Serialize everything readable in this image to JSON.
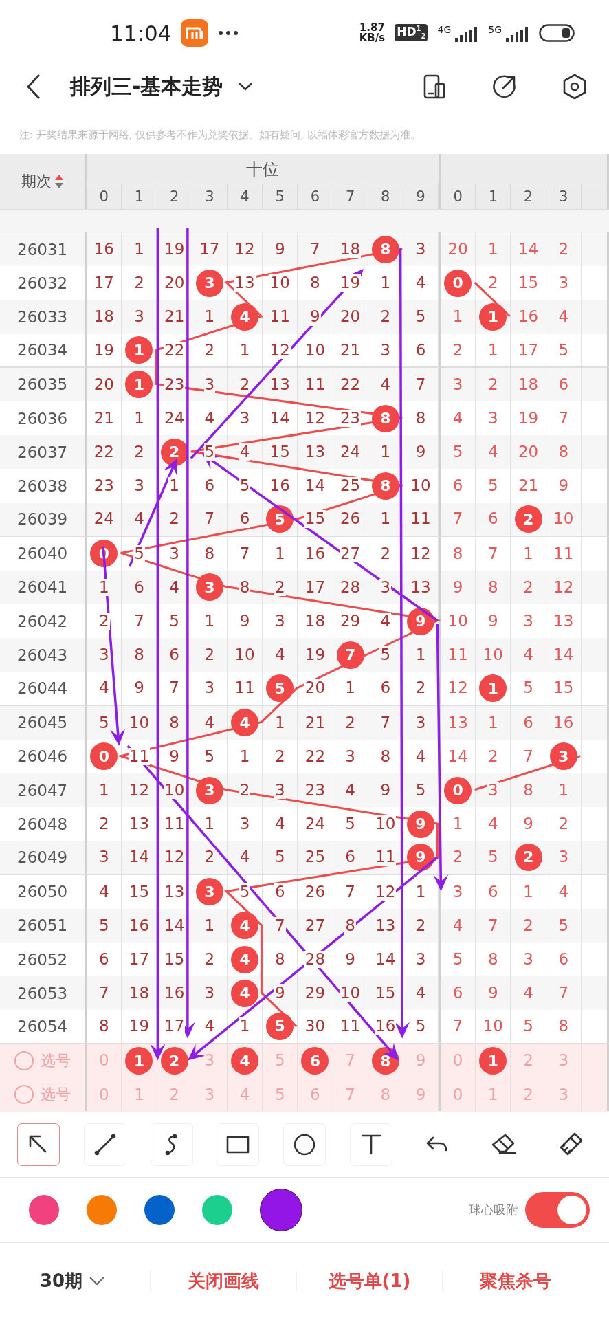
{
  "status_bar": {
    "time": "11:04",
    "speed_value": "1.87",
    "speed_unit": "KB/s",
    "hd_badge": "HD$^{1}$$_{2}$",
    "sim1": "4G",
    "sim2": "5G"
  },
  "header": {
    "title": "排列三-基本走势"
  },
  "note": "注: 开奖结果来源于网络, 仅供参考不作为兑奖依据。如有疑问, 以福体彩官方数据为准。",
  "table": {
    "period_header": "期次",
    "groups": [
      {
        "title": "十位",
        "digits": [
          "0",
          "1",
          "2",
          "3",
          "4",
          "5",
          "6",
          "7",
          "8",
          "9"
        ]
      },
      {
        "digits": [
          "0",
          "1",
          "2",
          "3"
        ]
      }
    ],
    "rows": [
      {
        "period": "26031",
        "groups": [
          [
            {
              "v": "16",
              "hit": false
            },
            {
              "v": "1",
              "hit": false
            },
            {
              "v": "19",
              "hit": false
            },
            {
              "v": "17",
              "hit": false
            },
            {
              "v": "12",
              "hit": false
            },
            {
              "v": "9",
              "hit": false
            },
            {
              "v": "7",
              "hit": false
            },
            {
              "v": "18",
              "hit": false
            },
            {
              "v": "8",
              "hit": true
            },
            {
              "v": "3",
              "hit": false
            }
          ],
          [
            {
              "v": "20",
              "hit": false
            },
            {
              "v": "1",
              "hit": false
            },
            {
              "v": "14",
              "hit": false
            },
            {
              "v": "2",
              "hit": false
            }
          ]
        ]
      },
      {
        "period": "26032",
        "groups": [
          [
            {
              "v": "17",
              "hit": false
            },
            {
              "v": "2",
              "hit": false
            },
            {
              "v": "20",
              "hit": false
            },
            {
              "v": "3",
              "hit": true
            },
            {
              "v": "13",
              "hit": false
            },
            {
              "v": "10",
              "hit": false
            },
            {
              "v": "8",
              "hit": false
            },
            {
              "v": "19",
              "hit": false
            },
            {
              "v": "1",
              "hit": false
            },
            {
              "v": "4",
              "hit": false
            }
          ],
          [
            {
              "v": "0",
              "hit": true
            },
            {
              "v": "2",
              "hit": false
            },
            {
              "v": "15",
              "hit": false
            },
            {
              "v": "3",
              "hit": false
            }
          ]
        ]
      },
      {
        "period": "26033",
        "groups": [
          [
            {
              "v": "18",
              "hit": false
            },
            {
              "v": "3",
              "hit": false
            },
            {
              "v": "21",
              "hit": false
            },
            {
              "v": "1",
              "hit": false
            },
            {
              "v": "4",
              "hit": true
            },
            {
              "v": "11",
              "hit": false
            },
            {
              "v": "9",
              "hit": false
            },
            {
              "v": "20",
              "hit": false
            },
            {
              "v": "2",
              "hit": false
            },
            {
              "v": "5",
              "hit": false
            }
          ],
          [
            {
              "v": "1",
              "hit": false
            },
            {
              "v": "1",
              "hit": true
            },
            {
              "v": "16",
              "hit": false
            },
            {
              "v": "4",
              "hit": false
            }
          ]
        ]
      },
      {
        "period": "26034",
        "groups": [
          [
            {
              "v": "19",
              "hit": false
            },
            {
              "v": "1",
              "hit": true
            },
            {
              "v": "22",
              "hit": false
            },
            {
              "v": "2",
              "hit": false
            },
            {
              "v": "1",
              "hit": false
            },
            {
              "v": "12",
              "hit": false
            },
            {
              "v": "10",
              "hit": false
            },
            {
              "v": "21",
              "hit": false
            },
            {
              "v": "3",
              "hit": false
            },
            {
              "v": "6",
              "hit": false
            }
          ],
          [
            {
              "v": "2",
              "hit": false
            },
            {
              "v": "1",
              "hit": false
            },
            {
              "v": "17",
              "hit": false
            },
            {
              "v": "5",
              "hit": false
            }
          ]
        ]
      },
      {
        "period": "26035",
        "groups": [
          [
            {
              "v": "20",
              "hit": false
            },
            {
              "v": "1",
              "hit": true
            },
            {
              "v": "23",
              "hit": false
            },
            {
              "v": "3",
              "hit": false
            },
            {
              "v": "2",
              "hit": false
            },
            {
              "v": "13",
              "hit": false
            },
            {
              "v": "11",
              "hit": false
            },
            {
              "v": "22",
              "hit": false
            },
            {
              "v": "4",
              "hit": false
            },
            {
              "v": "7",
              "hit": false
            }
          ],
          [
            {
              "v": "3",
              "hit": false
            },
            {
              "v": "2",
              "hit": false
            },
            {
              "v": "18",
              "hit": false
            },
            {
              "v": "6",
              "hit": false
            }
          ]
        ]
      },
      {
        "period": "26036",
        "groups": [
          [
            {
              "v": "21",
              "hit": false
            },
            {
              "v": "1",
              "hit": false
            },
            {
              "v": "24",
              "hit": false
            },
            {
              "v": "4",
              "hit": false
            },
            {
              "v": "3",
              "hit": false
            },
            {
              "v": "14",
              "hit": false
            },
            {
              "v": "12",
              "hit": false
            },
            {
              "v": "23",
              "hit": false
            },
            {
              "v": "8",
              "hit": true
            },
            {
              "v": "8",
              "hit": false
            }
          ],
          [
            {
              "v": "4",
              "hit": false
            },
            {
              "v": "3",
              "hit": false
            },
            {
              "v": "19",
              "hit": false
            },
            {
              "v": "7",
              "hit": false
            }
          ]
        ]
      },
      {
        "period": "26037",
        "groups": [
          [
            {
              "v": "22",
              "hit": false
            },
            {
              "v": "2",
              "hit": false
            },
            {
              "v": "2",
              "hit": true
            },
            {
              "v": "5",
              "hit": false
            },
            {
              "v": "4",
              "hit": false
            },
            {
              "v": "15",
              "hit": false
            },
            {
              "v": "13",
              "hit": false
            },
            {
              "v": "24",
              "hit": false
            },
            {
              "v": "1",
              "hit": false
            },
            {
              "v": "9",
              "hit": false
            }
          ],
          [
            {
              "v": "5",
              "hit": false
            },
            {
              "v": "4",
              "hit": false
            },
            {
              "v": "20",
              "hit": false
            },
            {
              "v": "8",
              "hit": false
            }
          ]
        ]
      },
      {
        "period": "26038",
        "groups": [
          [
            {
              "v": "23",
              "hit": false
            },
            {
              "v": "3",
              "hit": false
            },
            {
              "v": "1",
              "hit": false
            },
            {
              "v": "6",
              "hit": false
            },
            {
              "v": "5",
              "hit": false
            },
            {
              "v": "16",
              "hit": false
            },
            {
              "v": "14",
              "hit": false
            },
            {
              "v": "25",
              "hit": false
            },
            {
              "v": "8",
              "hit": true
            },
            {
              "v": "10",
              "hit": false
            }
          ],
          [
            {
              "v": "6",
              "hit": false
            },
            {
              "v": "5",
              "hit": false
            },
            {
              "v": "21",
              "hit": false
            },
            {
              "v": "9",
              "hit": false
            }
          ]
        ]
      },
      {
        "period": "26039",
        "groups": [
          [
            {
              "v": "24",
              "hit": false
            },
            {
              "v": "4",
              "hit": false
            },
            {
              "v": "2",
              "hit": false
            },
            {
              "v": "7",
              "hit": false
            },
            {
              "v": "6",
              "hit": false
            },
            {
              "v": "5",
              "hit": true
            },
            {
              "v": "15",
              "hit": false
            },
            {
              "v": "26",
              "hit": false
            },
            {
              "v": "1",
              "hit": false
            },
            {
              "v": "11",
              "hit": false
            }
          ],
          [
            {
              "v": "7",
              "hit": false
            },
            {
              "v": "6",
              "hit": false
            },
            {
              "v": "2",
              "hit": true
            },
            {
              "v": "10",
              "hit": false
            }
          ]
        ]
      },
      {
        "period": "26040",
        "groups": [
          [
            {
              "v": "0",
              "hit": true
            },
            {
              "v": "5",
              "hit": false
            },
            {
              "v": "3",
              "hit": false
            },
            {
              "v": "8",
              "hit": false
            },
            {
              "v": "7",
              "hit": false
            },
            {
              "v": "1",
              "hit": false
            },
            {
              "v": "16",
              "hit": false
            },
            {
              "v": "27",
              "hit": false
            },
            {
              "v": "2",
              "hit": false
            },
            {
              "v": "12",
              "hit": false
            }
          ],
          [
            {
              "v": "8",
              "hit": false
            },
            {
              "v": "7",
              "hit": false
            },
            {
              "v": "1",
              "hit": false
            },
            {
              "v": "11",
              "hit": false
            }
          ]
        ]
      },
      {
        "period": "26041",
        "groups": [
          [
            {
              "v": "1",
              "hit": false
            },
            {
              "v": "6",
              "hit": false
            },
            {
              "v": "4",
              "hit": false
            },
            {
              "v": "3",
              "hit": true
            },
            {
              "v": "8",
              "hit": false
            },
            {
              "v": "2",
              "hit": false
            },
            {
              "v": "17",
              "hit": false
            },
            {
              "v": "28",
              "hit": false
            },
            {
              "v": "3",
              "hit": false
            },
            {
              "v": "13",
              "hit": false
            }
          ],
          [
            {
              "v": "9",
              "hit": false
            },
            {
              "v": "8",
              "hit": false
            },
            {
              "v": "2",
              "hit": false
            },
            {
              "v": "12",
              "hit": false
            }
          ]
        ]
      },
      {
        "period": "26042",
        "groups": [
          [
            {
              "v": "2",
              "hit": false
            },
            {
              "v": "7",
              "hit": false
            },
            {
              "v": "5",
              "hit": false
            },
            {
              "v": "1",
              "hit": false
            },
            {
              "v": "9",
              "hit": false
            },
            {
              "v": "3",
              "hit": false
            },
            {
              "v": "18",
              "hit": false
            },
            {
              "v": "29",
              "hit": false
            },
            {
              "v": "4",
              "hit": false
            },
            {
              "v": "9",
              "hit": true
            }
          ],
          [
            {
              "v": "10",
              "hit": false
            },
            {
              "v": "9",
              "hit": false
            },
            {
              "v": "3",
              "hit": false
            },
            {
              "v": "13",
              "hit": false
            }
          ]
        ]
      },
      {
        "period": "26043",
        "groups": [
          [
            {
              "v": "3",
              "hit": false
            },
            {
              "v": "8",
              "hit": false
            },
            {
              "v": "6",
              "hit": false
            },
            {
              "v": "2",
              "hit": false
            },
            {
              "v": "10",
              "hit": false
            },
            {
              "v": "4",
              "hit": false
            },
            {
              "v": "19",
              "hit": false
            },
            {
              "v": "7",
              "hit": true
            },
            {
              "v": "5",
              "hit": false
            },
            {
              "v": "1",
              "hit": false
            }
          ],
          [
            {
              "v": "11",
              "hit": false
            },
            {
              "v": "10",
              "hit": false
            },
            {
              "v": "4",
              "hit": false
            },
            {
              "v": "14",
              "hit": false
            }
          ]
        ]
      },
      {
        "period": "26044",
        "groups": [
          [
            {
              "v": "4",
              "hit": false
            },
            {
              "v": "9",
              "hit": false
            },
            {
              "v": "7",
              "hit": false
            },
            {
              "v": "3",
              "hit": false
            },
            {
              "v": "11",
              "hit": false
            },
            {
              "v": "5",
              "hit": true
            },
            {
              "v": "20",
              "hit": false
            },
            {
              "v": "1",
              "hit": false
            },
            {
              "v": "6",
              "hit": false
            },
            {
              "v": "2",
              "hit": false
            }
          ],
          [
            {
              "v": "12",
              "hit": false
            },
            {
              "v": "1",
              "hit": true
            },
            {
              "v": "5",
              "hit": false
            },
            {
              "v": "15",
              "hit": false
            }
          ]
        ]
      },
      {
        "period": "26045",
        "groups": [
          [
            {
              "v": "5",
              "hit": false
            },
            {
              "v": "10",
              "hit": false
            },
            {
              "v": "8",
              "hit": false
            },
            {
              "v": "4",
              "hit": false
            },
            {
              "v": "4",
              "hit": true
            },
            {
              "v": "1",
              "hit": false
            },
            {
              "v": "21",
              "hit": false
            },
            {
              "v": "2",
              "hit": false
            },
            {
              "v": "7",
              "hit": false
            },
            {
              "v": "3",
              "hit": false
            }
          ],
          [
            {
              "v": "13",
              "hit": false
            },
            {
              "v": "1",
              "hit": false
            },
            {
              "v": "6",
              "hit": false
            },
            {
              "v": "16",
              "hit": false
            }
          ]
        ]
      },
      {
        "period": "26046",
        "groups": [
          [
            {
              "v": "0",
              "hit": true
            },
            {
              "v": "11",
              "hit": false
            },
            {
              "v": "9",
              "hit": false
            },
            {
              "v": "5",
              "hit": false
            },
            {
              "v": "1",
              "hit": false
            },
            {
              "v": "2",
              "hit": false
            },
            {
              "v": "22",
              "hit": false
            },
            {
              "v": "3",
              "hit": false
            },
            {
              "v": "8",
              "hit": false
            },
            {
              "v": "4",
              "hit": false
            }
          ],
          [
            {
              "v": "14",
              "hit": false
            },
            {
              "v": "2",
              "hit": false
            },
            {
              "v": "7",
              "hit": false
            },
            {
              "v": "3",
              "hit": true
            }
          ]
        ]
      },
      {
        "period": "26047",
        "groups": [
          [
            {
              "v": "1",
              "hit": false
            },
            {
              "v": "12",
              "hit": false
            },
            {
              "v": "10",
              "hit": false
            },
            {
              "v": "3",
              "hit": true
            },
            {
              "v": "2",
              "hit": false
            },
            {
              "v": "3",
              "hit": false
            },
            {
              "v": "23",
              "hit": false
            },
            {
              "v": "4",
              "hit": false
            },
            {
              "v": "9",
              "hit": false
            },
            {
              "v": "5",
              "hit": false
            }
          ],
          [
            {
              "v": "0",
              "hit": true
            },
            {
              "v": "3",
              "hit": false
            },
            {
              "v": "8",
              "hit": false
            },
            {
              "v": "1",
              "hit": false
            }
          ]
        ]
      },
      {
        "period": "26048",
        "groups": [
          [
            {
              "v": "2",
              "hit": false
            },
            {
              "v": "13",
              "hit": false
            },
            {
              "v": "11",
              "hit": false
            },
            {
              "v": "1",
              "hit": false
            },
            {
              "v": "3",
              "hit": false
            },
            {
              "v": "4",
              "hit": false
            },
            {
              "v": "24",
              "hit": false
            },
            {
              "v": "5",
              "hit": false
            },
            {
              "v": "10",
              "hit": false
            },
            {
              "v": "9",
              "hit": true
            }
          ],
          [
            {
              "v": "1",
              "hit": false
            },
            {
              "v": "4",
              "hit": false
            },
            {
              "v": "9",
              "hit": false
            },
            {
              "v": "2",
              "hit": false
            }
          ]
        ]
      },
      {
        "period": "26049",
        "groups": [
          [
            {
              "v": "3",
              "hit": false
            },
            {
              "v": "14",
              "hit": false
            },
            {
              "v": "12",
              "hit": false
            },
            {
              "v": "2",
              "hit": false
            },
            {
              "v": "4",
              "hit": false
            },
            {
              "v": "5",
              "hit": false
            },
            {
              "v": "25",
              "hit": false
            },
            {
              "v": "6",
              "hit": false
            },
            {
              "v": "11",
              "hit": false
            },
            {
              "v": "9",
              "hit": true
            }
          ],
          [
            {
              "v": "2",
              "hit": false
            },
            {
              "v": "5",
              "hit": false
            },
            {
              "v": "2",
              "hit": true
            },
            {
              "v": "3",
              "hit": false
            }
          ]
        ]
      },
      {
        "period": "26050",
        "groups": [
          [
            {
              "v": "4",
              "hit": false
            },
            {
              "v": "15",
              "hit": false
            },
            {
              "v": "13",
              "hit": false
            },
            {
              "v": "3",
              "hit": true
            },
            {
              "v": "5",
              "hit": false
            },
            {
              "v": "6",
              "hit": false
            },
            {
              "v": "26",
              "hit": false
            },
            {
              "v": "7",
              "hit": false
            },
            {
              "v": "12",
              "hit": false
            },
            {
              "v": "1",
              "hit": false
            }
          ],
          [
            {
              "v": "3",
              "hit": false
            },
            {
              "v": "6",
              "hit": false
            },
            {
              "v": "1",
              "hit": false
            },
            {
              "v": "4",
              "hit": false
            }
          ]
        ]
      },
      {
        "period": "26051",
        "groups": [
          [
            {
              "v": "5",
              "hit": false
            },
            {
              "v": "16",
              "hit": false
            },
            {
              "v": "14",
              "hit": false
            },
            {
              "v": "1",
              "hit": false
            },
            {
              "v": "4",
              "hit": true
            },
            {
              "v": "7",
              "hit": false
            },
            {
              "v": "27",
              "hit": false
            },
            {
              "v": "8",
              "hit": false
            },
            {
              "v": "13",
              "hit": false
            },
            {
              "v": "2",
              "hit": false
            }
          ],
          [
            {
              "v": "4",
              "hit": false
            },
            {
              "v": "7",
              "hit": false
            },
            {
              "v": "2",
              "hit": false
            },
            {
              "v": "5",
              "hit": false
            }
          ]
        ]
      },
      {
        "period": "26052",
        "groups": [
          [
            {
              "v": "6",
              "hit": false
            },
            {
              "v": "17",
              "hit": false
            },
            {
              "v": "15",
              "hit": false
            },
            {
              "v": "2",
              "hit": false
            },
            {
              "v": "4",
              "hit": true
            },
            {
              "v": "8",
              "hit": false
            },
            {
              "v": "28",
              "hit": false
            },
            {
              "v": "9",
              "hit": false
            },
            {
              "v": "14",
              "hit": false
            },
            {
              "v": "3",
              "hit": false
            }
          ],
          [
            {
              "v": "5",
              "hit": false
            },
            {
              "v": "8",
              "hit": false
            },
            {
              "v": "3",
              "hit": false
            },
            {
              "v": "6",
              "hit": false
            }
          ]
        ]
      },
      {
        "period": "26053",
        "groups": [
          [
            {
              "v": "7",
              "hit": false
            },
            {
              "v": "18",
              "hit": false
            },
            {
              "v": "16",
              "hit": false
            },
            {
              "v": "3",
              "hit": false
            },
            {
              "v": "4",
              "hit": true
            },
            {
              "v": "9",
              "hit": false
            },
            {
              "v": "29",
              "hit": false
            },
            {
              "v": "10",
              "hit": false
            },
            {
              "v": "15",
              "hit": false
            },
            {
              "v": "4",
              "hit": false
            }
          ],
          [
            {
              "v": "6",
              "hit": false
            },
            {
              "v": "9",
              "hit": false
            },
            {
              "v": "4",
              "hit": false
            },
            {
              "v": "7",
              "hit": false
            }
          ]
        ]
      },
      {
        "period": "26054",
        "groups": [
          [
            {
              "v": "8",
              "hit": false
            },
            {
              "v": "19",
              "hit": false
            },
            {
              "v": "17",
              "hit": false
            },
            {
              "v": "4",
              "hit": false
            },
            {
              "v": "1",
              "hit": false
            },
            {
              "v": "5",
              "hit": true
            },
            {
              "v": "30",
              "hit": false
            },
            {
              "v": "11",
              "hit": false
            },
            {
              "v": "16",
              "hit": false
            },
            {
              "v": "5",
              "hit": false
            }
          ],
          [
            {
              "v": "7",
              "hit": false
            },
            {
              "v": "10",
              "hit": false
            },
            {
              "v": "5",
              "hit": false
            },
            {
              "v": "8",
              "hit": false
            }
          ]
        ]
      }
    ],
    "pick_rows": [
      {
        "label": "选号",
        "checked": false,
        "groups": [
          [
            {
              "v": "0",
              "selected": false
            },
            {
              "v": "1",
              "selected": true
            },
            {
              "v": "2",
              "selected": true
            },
            {
              "v": "3",
              "selected": false
            },
            {
              "v": "4",
              "selected": true
            },
            {
              "v": "5",
              "selected": false
            },
            {
              "v": "6",
              "selected": true
            },
            {
              "v": "7",
              "selected": false
            },
            {
              "v": "8",
              "selected": true
            },
            {
              "v": "9",
              "selected": false
            }
          ],
          [
            {
              "v": "0",
              "selected": false
            },
            {
              "v": "1",
              "selected": true
            },
            {
              "v": "2",
              "selected": false
            },
            {
              "v": "3",
              "selected": false
            }
          ]
        ]
      },
      {
        "label": "选号",
        "checked": false,
        "groups": [
          [
            {
              "v": "0",
              "selected": false
            },
            {
              "v": "1",
              "selected": false
            },
            {
              "v": "2",
              "selected": false
            },
            {
              "v": "3",
              "selected": false
            },
            {
              "v": "4",
              "selected": false
            },
            {
              "v": "5",
              "selected": false
            },
            {
              "v": "6",
              "selected": false
            },
            {
              "v": "7",
              "selected": false
            },
            {
              "v": "8",
              "selected": false
            },
            {
              "v": "9",
              "selected": false
            }
          ],
          [
            {
              "v": "0",
              "selected": false
            },
            {
              "v": "1",
              "selected": false
            },
            {
              "v": "2",
              "selected": false
            },
            {
              "v": "3",
              "selected": false
            }
          ]
        ]
      }
    ]
  },
  "tools": [
    {
      "kind": "pointer",
      "selected": true
    },
    {
      "kind": "line",
      "selected": false
    },
    {
      "kind": "curve",
      "selected": false
    },
    {
      "kind": "rect",
      "selected": false
    },
    {
      "kind": "circle",
      "selected": false
    },
    {
      "kind": "text",
      "selected": false
    },
    {
      "kind": "undo",
      "selected": false
    },
    {
      "kind": "eraser",
      "selected": false
    },
    {
      "kind": "clear",
      "selected": false
    }
  ],
  "colors": [
    {
      "color": "#f2417f",
      "selected": false
    },
    {
      "color": "#f77a06",
      "selected": false
    },
    {
      "color": "#0562c9",
      "selected": false
    },
    {
      "color": "#1ccf8f",
      "selected": false
    },
    {
      "color": "#9316e6",
      "selected": true
    }
  ],
  "snap_switch": {
    "label": "球心吸附",
    "on": true
  },
  "bottom_bar": {
    "period_select": "30期",
    "actions": [
      "关闭画线",
      "选号单(1)",
      "聚焦杀号"
    ]
  }
}
